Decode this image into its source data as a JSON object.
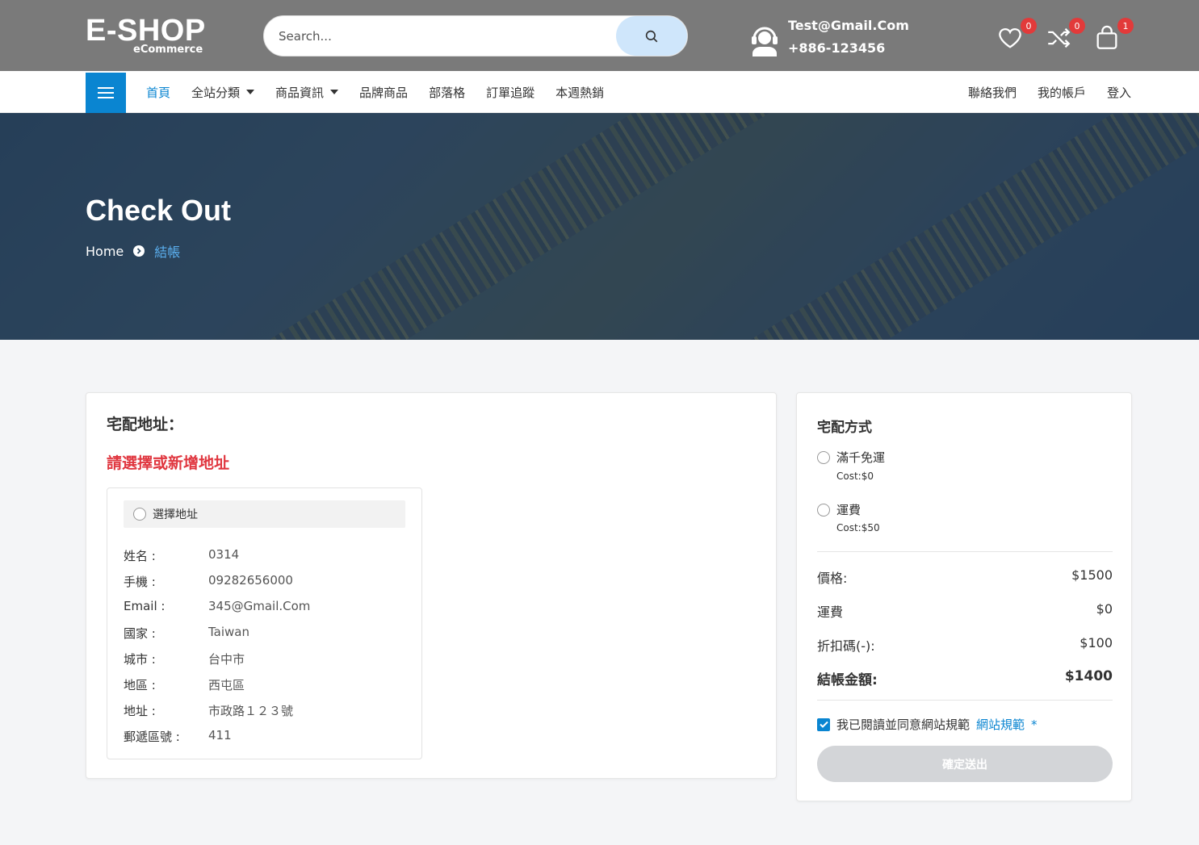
{
  "header": {
    "logo_main": "E-SHOP",
    "logo_sub": "eCommerce",
    "search_placeholder": "Search...",
    "contact_email": "Test@Gmail.Com",
    "contact_phone": "+886-123456",
    "wishlist_count": "0",
    "compare_count": "0",
    "cart_count": "1"
  },
  "nav": {
    "items": [
      {
        "label": "首頁",
        "active": true
      },
      {
        "label": "全站分類",
        "dropdown": true
      },
      {
        "label": "商品資訊",
        "dropdown": true
      },
      {
        "label": "品牌商品"
      },
      {
        "label": "部落格"
      },
      {
        "label": "訂單追蹤"
      },
      {
        "label": "本週熱銷"
      }
    ],
    "right": [
      "聯絡我們",
      "我的帳戶",
      "登入"
    ]
  },
  "hero": {
    "title": "Check Out",
    "breadcrumb_home": "Home",
    "breadcrumb_current": "結帳"
  },
  "address": {
    "title": "宅配地址：",
    "warning": "請選擇或新增地址",
    "choose_label": "選擇地址",
    "rows": [
      {
        "label": "姓名 :",
        "value": "0314"
      },
      {
        "label": "手機 :",
        "value": "09282656000"
      },
      {
        "label": "Email :",
        "value": "345@Gmail.Com"
      },
      {
        "label": "國家 :",
        "value": "Taiwan"
      },
      {
        "label": "城市 :",
        "value": "台中市"
      },
      {
        "label": "地區 :",
        "value": "西屯區"
      },
      {
        "label": "地址 :",
        "value": "市政路１２３號"
      },
      {
        "label": "郵遞區號 :",
        "value": "411"
      }
    ]
  },
  "shipping": {
    "title": "宅配方式",
    "options": [
      {
        "label": "滿千免運",
        "cost": "Cost:$0"
      },
      {
        "label": "運費",
        "cost": "Cost:$50"
      }
    ]
  },
  "summary": {
    "price_label": "價格:",
    "price_value": "$1500",
    "shipping_label": "運費",
    "shipping_value": "$0",
    "discount_label": "折扣碼(-):",
    "discount_value": "$100",
    "total_label": "結帳金額:",
    "total_value": "$1400"
  },
  "agree": {
    "text": "我已閱讀並同意網站規範",
    "link": "網站規範",
    "required": "*"
  },
  "submit_label": "確定送出",
  "colors": {
    "accent": "#0a85d1",
    "warning": "#e0363f",
    "header_bg": "#7a7a7a",
    "badge": "#e23a3a"
  }
}
